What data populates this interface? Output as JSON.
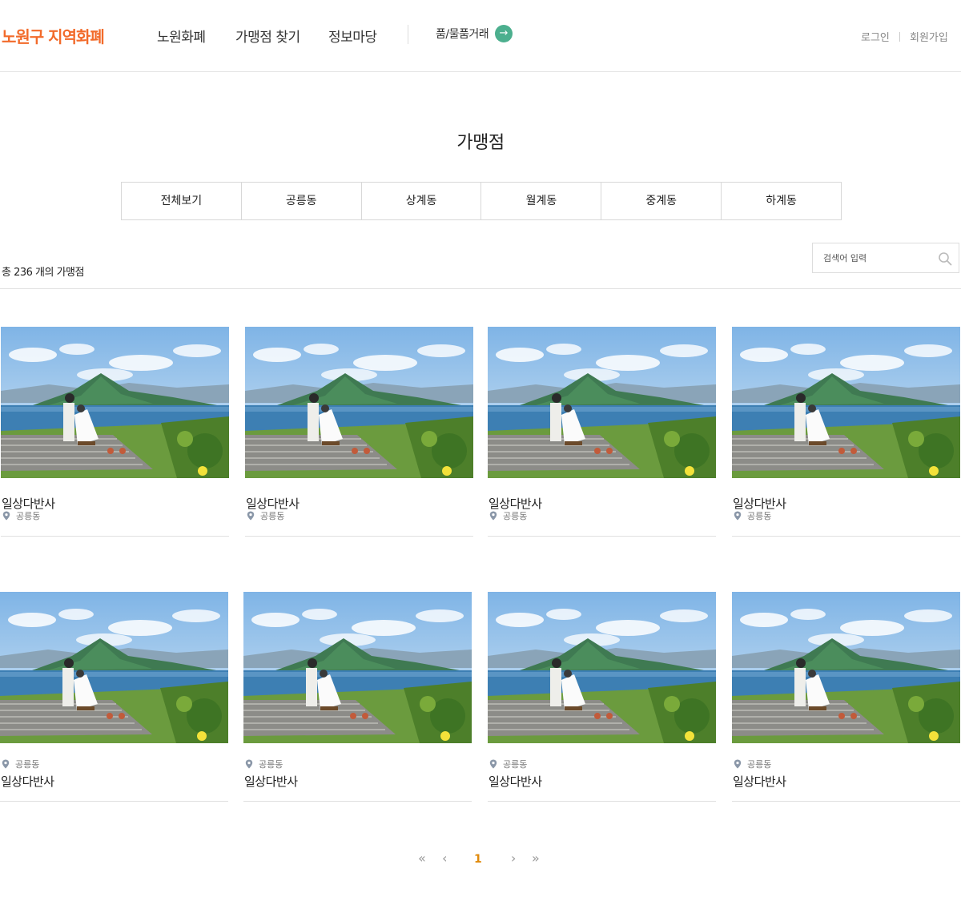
{
  "header": {
    "logo": "노원구 지역화폐",
    "nav": [
      "노원화폐",
      "가맹점 찾기",
      "정보마당"
    ],
    "trade_label": "품/물품거래",
    "trade_arrow": "→",
    "login": "로그인",
    "join": "회원가입"
  },
  "page": {
    "title": "가맹점",
    "tabs": [
      "전체보기",
      "공릉동",
      "상계동",
      "월계동",
      "중계동",
      "하계동"
    ],
    "count_text": "총 236 개의 가맹점",
    "search_placeholder": "검색어 입력"
  },
  "stores": [
    {
      "name": "일상다반사",
      "district": "공릉동"
    },
    {
      "name": "일상다반사",
      "district": "공릉동"
    },
    {
      "name": "일상다반사",
      "district": "공릉동"
    },
    {
      "name": "일상다반사",
      "district": "공릉동"
    },
    {
      "name": "일상다반사",
      "district": "공릉동"
    },
    {
      "name": "일상다반사",
      "district": "공릉동"
    },
    {
      "name": "일상다반사",
      "district": "공릉동"
    },
    {
      "name": "일상다반사",
      "district": "공릉동"
    }
  ],
  "pagination": {
    "first": "«",
    "prev": "‹",
    "current": "1",
    "next": "›",
    "last": "»"
  },
  "colors": {
    "logo": "#f26b2b",
    "trade_arrow": "#4caf8e",
    "current_page": "#e08a0b"
  },
  "icons": [
    "arrow-right-icon",
    "search-icon",
    "location-pin-icon",
    "double-chevron-left-icon",
    "chevron-left-icon",
    "chevron-right-icon",
    "double-chevron-right-icon"
  ]
}
